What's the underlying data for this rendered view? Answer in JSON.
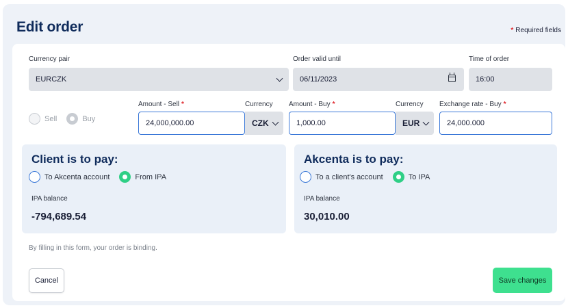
{
  "header": {
    "title": "Edit order",
    "required_note": "Required fields",
    "required_marker": "*"
  },
  "currency_pair": {
    "label": "Currency pair",
    "value": "EURCZK"
  },
  "order_valid_until": {
    "label": "Order valid until",
    "value": "06/11/2023"
  },
  "time_of_order": {
    "label": "Time of order",
    "value": "16:00"
  },
  "direction": {
    "options": [
      {
        "label": "Sell",
        "selected": false
      },
      {
        "label": "Buy",
        "selected": true
      }
    ]
  },
  "amount_sell": {
    "label": "Amount - Sell",
    "value": "24,000,000.00"
  },
  "currency_sell": {
    "label": "Currency",
    "value": "CZK"
  },
  "amount_buy": {
    "label": "Amount - Buy",
    "value": "1,000.00"
  },
  "currency_buy": {
    "label": "Currency",
    "value": "EUR"
  },
  "exchange_rate": {
    "label": "Exchange rate - Buy",
    "value": "24,000.000"
  },
  "client_pay": {
    "title": "Client is to pay:",
    "options": [
      {
        "label": "To Akcenta account",
        "selected": false
      },
      {
        "label": "From IPA",
        "selected": true
      }
    ],
    "balance_label": "IPA balance",
    "balance_value": "-794,689.54"
  },
  "akcenta_pay": {
    "title": "Akcenta is to pay:",
    "options": [
      {
        "label": "To a client's account",
        "selected": false
      },
      {
        "label": "To IPA",
        "selected": true
      }
    ],
    "balance_label": "IPA balance",
    "balance_value": "30,010.00"
  },
  "binding_note": "By filling in this form, your order is binding.",
  "buttons": {
    "cancel": "Cancel",
    "save": "Save changes"
  },
  "colors": {
    "accent": "#3a78d8",
    "title": "#0f2b5b",
    "required": "#e0282e",
    "success": "#3ee08f",
    "panel_bg": "#eaf0f8"
  }
}
